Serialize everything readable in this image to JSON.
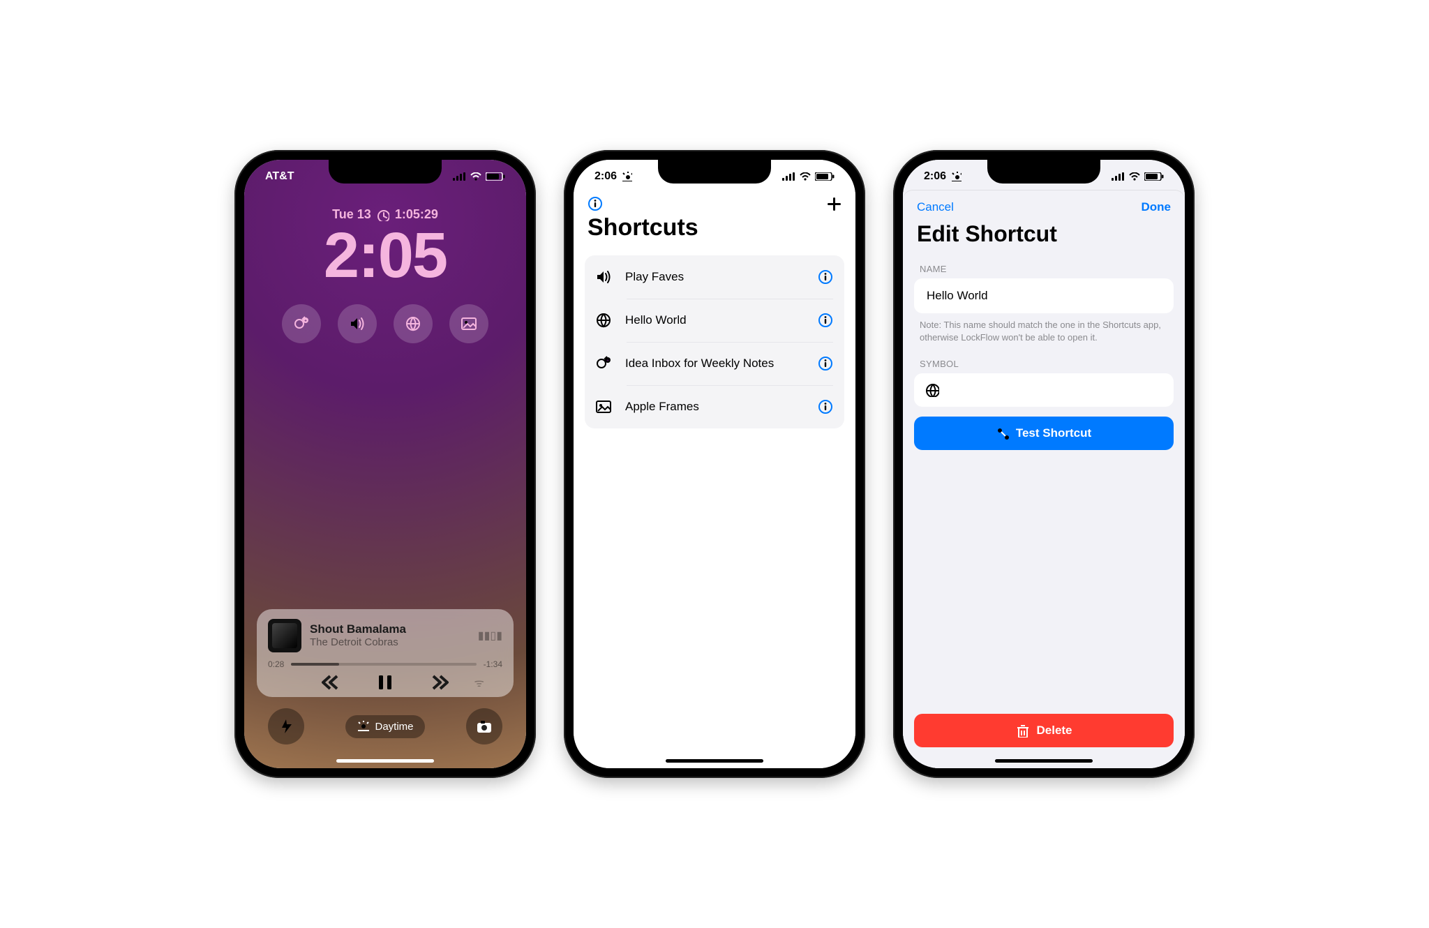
{
  "lock": {
    "carrier": "AT&T",
    "date": "Tue 13",
    "timer": "1:05:29",
    "time": "2:05",
    "widgets": [
      "idea-inbox-icon",
      "speaker-icon",
      "globe-icon",
      "photo-icon"
    ],
    "now_playing": {
      "title": "Shout Bamalama",
      "artist": "The Detroit Cobras",
      "elapsed": "0:28",
      "remaining": "-1:34"
    },
    "focus": "Daytime"
  },
  "shortcuts": {
    "status_time": "2:06",
    "title": "Shortcuts",
    "rows": [
      {
        "icon": "speaker-icon",
        "label": "Play Faves"
      },
      {
        "icon": "globe-icon",
        "label": "Hello World"
      },
      {
        "icon": "idea-inbox-icon",
        "label": "Idea Inbox for Weekly Notes"
      },
      {
        "icon": "photo-icon",
        "label": "Apple Frames"
      }
    ]
  },
  "edit": {
    "status_time": "2:06",
    "cancel": "Cancel",
    "done": "Done",
    "title": "Edit Shortcut",
    "name_label": "NAME",
    "name_value": "Hello World",
    "note": "Note: This name should match the one in the Shortcuts app, otherwise LockFlow won't be able to open it.",
    "symbol_label": "SYMBOL",
    "test": "Test Shortcut",
    "delete": "Delete"
  }
}
